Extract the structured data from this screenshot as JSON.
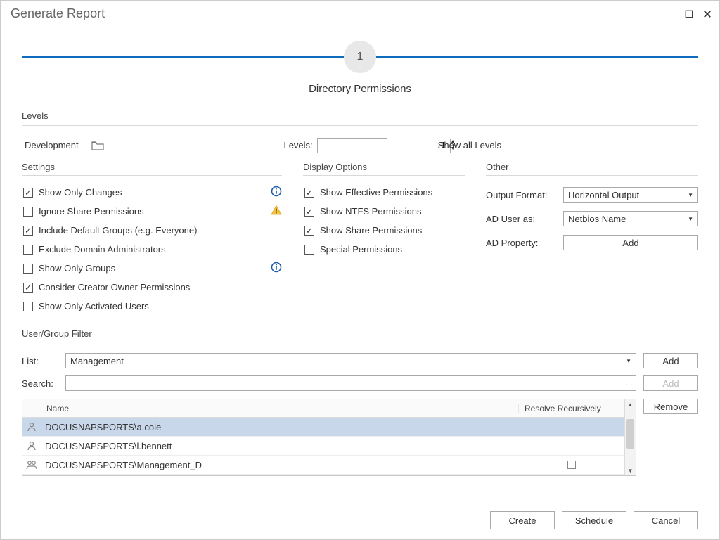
{
  "window": {
    "title": "Generate Report"
  },
  "step": {
    "number": "1",
    "subtitle": "Directory Permissions"
  },
  "levels": {
    "section": "Levels",
    "path_label": "Development",
    "levels_label": "Levels:",
    "levels_value": "1",
    "show_all": "Show all Levels",
    "show_all_checked": false
  },
  "settings": {
    "section": "Settings",
    "items": [
      {
        "label": "Show Only Changes",
        "checked": true,
        "icon": "info"
      },
      {
        "label": "Ignore Share Permissions",
        "checked": false,
        "icon": "warn"
      },
      {
        "label": "Include Default Groups (e.g. Everyone)",
        "checked": true
      },
      {
        "label": "Exclude Domain Administrators",
        "checked": false
      },
      {
        "label": "Show Only Groups",
        "checked": false,
        "icon": "info"
      },
      {
        "label": "Consider Creator Owner Permissions",
        "checked": true
      },
      {
        "label": "Show Only Activated Users",
        "checked": false
      }
    ]
  },
  "display": {
    "section": "Display Options",
    "items": [
      {
        "label": "Show Effective Permissions",
        "checked": true
      },
      {
        "label": "Show NTFS Permissions",
        "checked": true
      },
      {
        "label": "Show Share Permissions",
        "checked": true
      },
      {
        "label": "Special Permissions",
        "checked": false
      }
    ]
  },
  "other": {
    "section": "Other",
    "output_label": "Output Format:",
    "output_value": "Horizontal Output",
    "aduser_label": "AD User as:",
    "aduser_value": "Netbios Name",
    "adprop_label": "AD Property:",
    "add": "Add"
  },
  "filter": {
    "section": "User/Group Filter",
    "list_label": "List:",
    "list_value": "Management",
    "search_label": "Search:",
    "search_value": "",
    "add": "Add",
    "remove": "Remove",
    "col_name": "Name",
    "col_resolve": "Resolve Recursively",
    "rows": [
      {
        "name": "DOCUSNAPSPORTS\\a.cole",
        "type": "user",
        "selected": true
      },
      {
        "name": "DOCUSNAPSPORTS\\l.bennett",
        "type": "user",
        "selected": false
      },
      {
        "name": "DOCUSNAPSPORTS\\Management_D",
        "type": "group",
        "selected": false,
        "checkbox": true
      }
    ]
  },
  "footer": {
    "create": "Create",
    "schedule": "Schedule",
    "cancel": "Cancel"
  }
}
